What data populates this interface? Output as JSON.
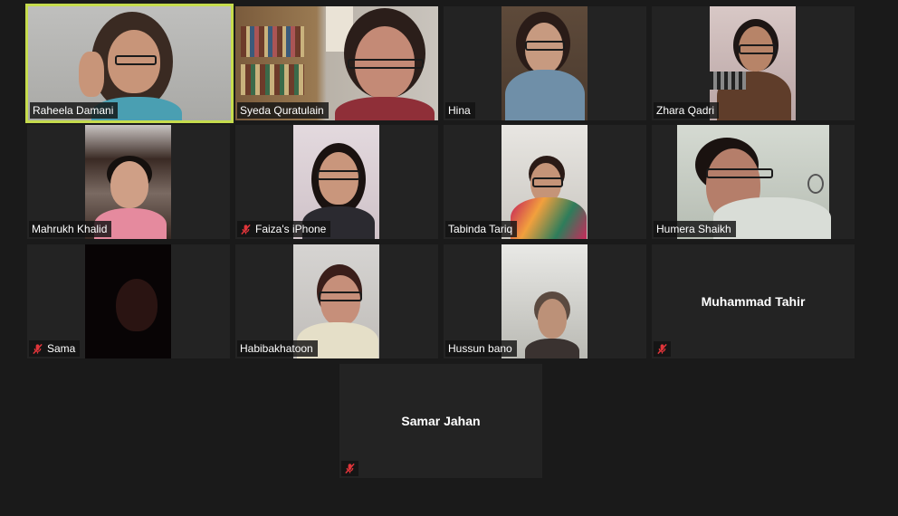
{
  "participants": [
    {
      "name": "Raheela Damani",
      "muted": false,
      "active": true
    },
    {
      "name": "Syeda Quratulain",
      "muted": false,
      "active": false
    },
    {
      "name": "Hina",
      "muted": false,
      "active": false
    },
    {
      "name": "Zhara Qadri",
      "muted": false,
      "active": false
    },
    {
      "name": "Mahrukh Khalid",
      "muted": false,
      "active": false
    },
    {
      "name": "Faiza's iPhone",
      "muted": true,
      "active": false
    },
    {
      "name": "Tabinda Tariq",
      "muted": false,
      "active": false
    },
    {
      "name": "Humera Shaikh",
      "muted": false,
      "active": false
    },
    {
      "name": "Sama",
      "muted": true,
      "active": false
    },
    {
      "name": "Habibakhatoon",
      "muted": false,
      "active": false
    },
    {
      "name": "Hussun bano",
      "muted": false,
      "active": false
    },
    {
      "name": "Muhammad Tahir",
      "muted": true,
      "video": false
    },
    {
      "name": "Samar Jahan",
      "muted": true,
      "video": false
    }
  ],
  "colors": {
    "background": "#1a1a1a",
    "tile": "#232323",
    "active_speaker_border": "#c6dc4d",
    "mute_icon": "#e0353a"
  },
  "icons": {
    "mute": "microphone-muted-icon"
  }
}
